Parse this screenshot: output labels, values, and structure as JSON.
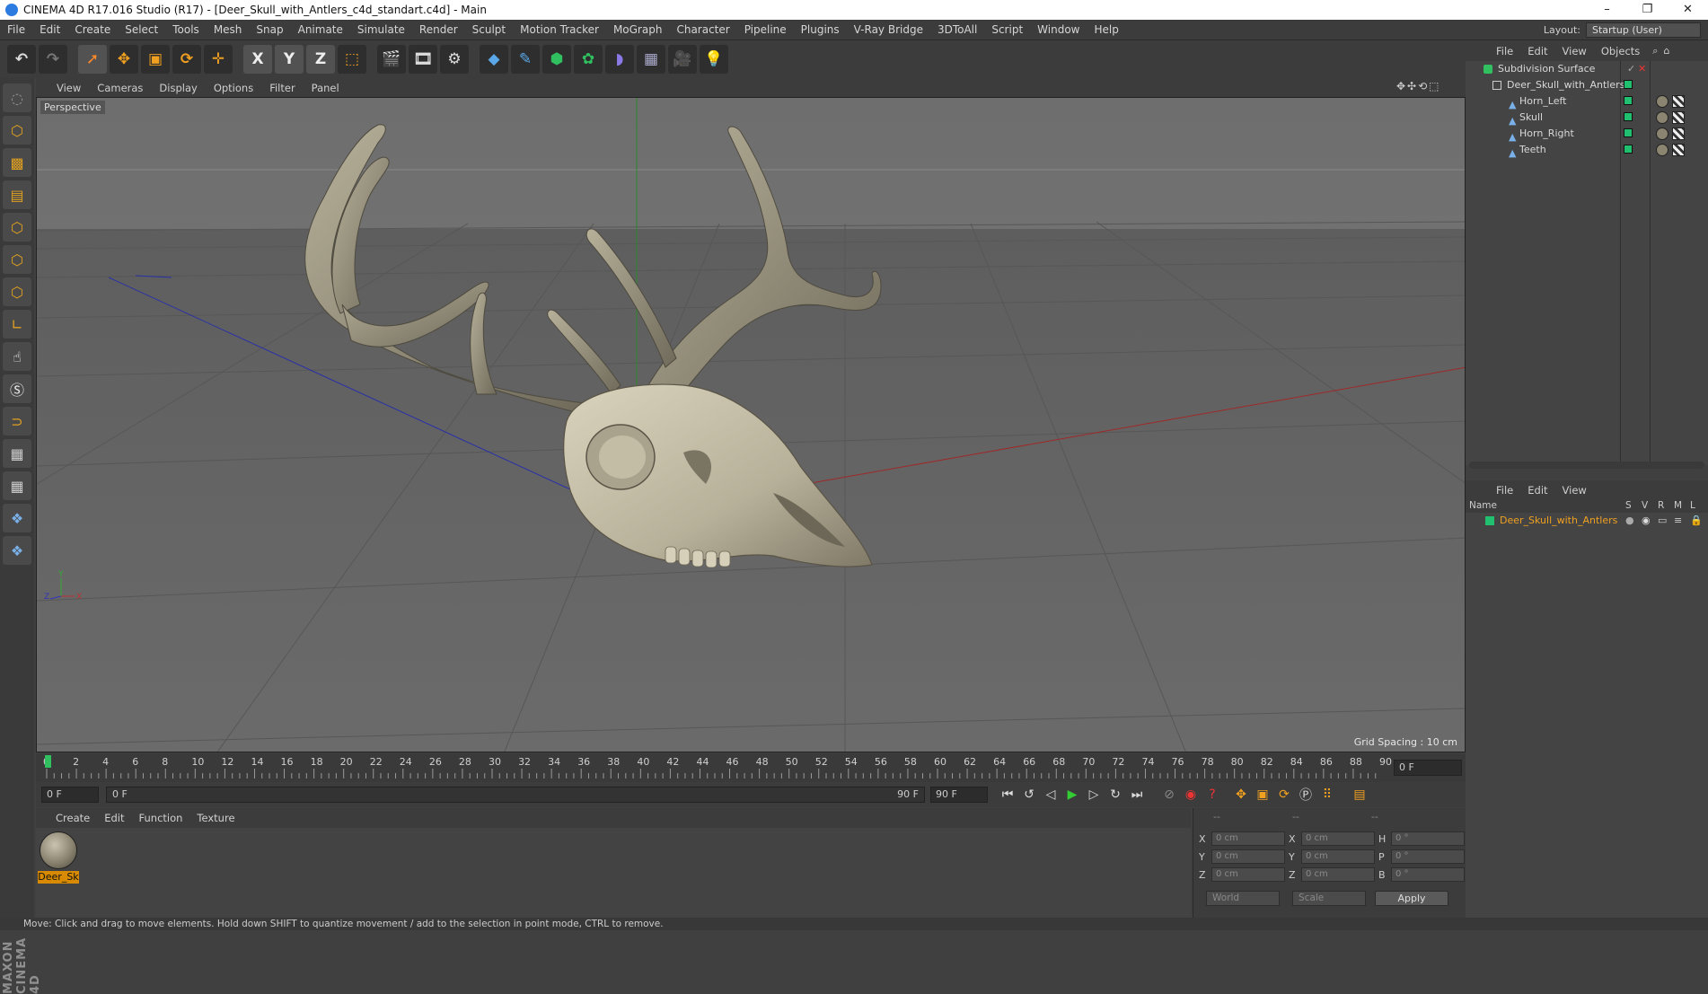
{
  "window": {
    "title": "CINEMA 4D R17.016 Studio (R17) - [Deer_Skull_with_Antlers_c4d_standart.c4d] - Main",
    "controls": [
      "–",
      "❐",
      "✕"
    ]
  },
  "menubar": {
    "items": [
      "File",
      "Edit",
      "Create",
      "Select",
      "Tools",
      "Mesh",
      "Snap",
      "Animate",
      "Simulate",
      "Render",
      "Sculpt",
      "Motion Tracker",
      "MoGraph",
      "Character",
      "Pipeline",
      "Plugins",
      "V-Ray Bridge",
      "3DToAll",
      "Script",
      "Window",
      "Help"
    ],
    "layout_label": "Layout:",
    "layout_value": "Startup (User)"
  },
  "toolbar": {
    "axis_x": "X",
    "axis_y": "Y",
    "axis_z": "Z"
  },
  "viewport": {
    "menu": [
      "View",
      "Cameras",
      "Display",
      "Options",
      "Filter",
      "Panel"
    ],
    "label": "Perspective",
    "grid_spacing": "Grid Spacing : 10 cm"
  },
  "timeline": {
    "ticks": [
      "0",
      "2",
      "4",
      "6",
      "8",
      "10",
      "12",
      "14",
      "16",
      "18",
      "20",
      "22",
      "24",
      "26",
      "28",
      "30",
      "32",
      "34",
      "36",
      "38",
      "40",
      "42",
      "44",
      "46",
      "48",
      "50",
      "52",
      "54",
      "56",
      "58",
      "60",
      "62",
      "64",
      "66",
      "68",
      "70",
      "72",
      "74",
      "76",
      "78",
      "80",
      "82",
      "84",
      "86",
      "88",
      "90"
    ],
    "current_frame": "0 F"
  },
  "transport": {
    "start": "0 F",
    "range_start": "0 F",
    "range_end": "90 F",
    "end": "90 F"
  },
  "materials": {
    "menu": [
      "Create",
      "Edit",
      "Function",
      "Texture"
    ],
    "items": [
      {
        "name": "Deer_Sk"
      }
    ]
  },
  "coords": {
    "header": [
      "--",
      "--",
      "--"
    ],
    "rows": [
      {
        "pos_label": "X",
        "pos": "0 cm",
        "size_label": "X",
        "size": "0 cm",
        "rot_label": "H",
        "rot": "0 °"
      },
      {
        "pos_label": "Y",
        "pos": "0 cm",
        "size_label": "Y",
        "size": "0 cm",
        "rot_label": "P",
        "rot": "0 °"
      },
      {
        "pos_label": "Z",
        "pos": "0 cm",
        "size_label": "Z",
        "size": "0 cm",
        "rot_label": "B",
        "rot": "0 °"
      }
    ],
    "space": "World",
    "mode": "Scale",
    "apply": "Apply"
  },
  "objects": {
    "menu": [
      "File",
      "Edit",
      "View",
      "Objects"
    ],
    "tree": [
      {
        "name": "Subdivision Surface",
        "depth": 0
      },
      {
        "name": "Deer_Skull_with_Antlers",
        "depth": 1
      },
      {
        "name": "Horn_Left",
        "depth": 2
      },
      {
        "name": "Skull",
        "depth": 2
      },
      {
        "name": "Horn_Right",
        "depth": 2
      },
      {
        "name": "Teeth",
        "depth": 2
      }
    ]
  },
  "attributes": {
    "menu": [
      "File",
      "Edit",
      "View"
    ],
    "columns": {
      "name": "Name",
      "s": "S",
      "v": "V",
      "r": "R",
      "m": "M",
      "l": "L"
    },
    "layer": "Deer_Skull_with_Antlers"
  },
  "status": {
    "text": "Move: Click and drag to move elements. Hold down SHIFT to quantize movement / add to the selection in point mode, CTRL to remove."
  },
  "colors": {
    "accent_orange": "#d88b00",
    "layer_green": "#20c070",
    "axis_x": "#c03030",
    "axis_y": "#30a030",
    "axis_z": "#3040c0"
  }
}
